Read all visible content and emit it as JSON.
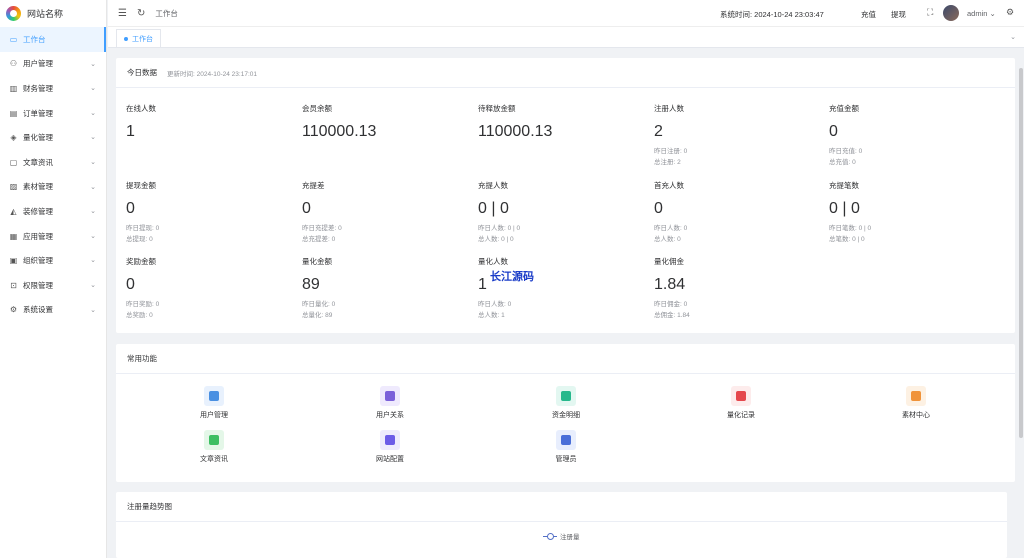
{
  "app": {
    "logo_text": "网站名称"
  },
  "sidebar": {
    "items": [
      {
        "label": "工作台",
        "icon": "monitor-icon",
        "glyph": "▭",
        "active": true,
        "has_children": false
      },
      {
        "label": "用户管理",
        "icon": "user-icon",
        "glyph": "⚇",
        "has_children": true
      },
      {
        "label": "财务管理",
        "icon": "finance-icon",
        "glyph": "▥",
        "has_children": true
      },
      {
        "label": "订单管理",
        "icon": "order-icon",
        "glyph": "▤",
        "has_children": true
      },
      {
        "label": "量化管理",
        "icon": "quant-icon",
        "glyph": "◈",
        "has_children": true
      },
      {
        "label": "文章资讯",
        "icon": "article-icon",
        "glyph": "▢",
        "has_children": true
      },
      {
        "label": "素材管理",
        "icon": "material-icon",
        "glyph": "▨",
        "has_children": true
      },
      {
        "label": "装修管理",
        "icon": "decorate-icon",
        "glyph": "◭",
        "has_children": true
      },
      {
        "label": "应用管理",
        "icon": "app-icon",
        "glyph": "▦",
        "has_children": true
      },
      {
        "label": "组织管理",
        "icon": "org-icon",
        "glyph": "▣",
        "has_children": true
      },
      {
        "label": "权限管理",
        "icon": "lock-icon",
        "glyph": "⊡",
        "has_children": true
      },
      {
        "label": "系统设置",
        "icon": "gear-icon",
        "glyph": "⚙",
        "has_children": true
      }
    ]
  },
  "header": {
    "breadcrumb": "工作台",
    "system_time_label": "系统时间: ",
    "system_time": "2024-10-24 23:03:47",
    "recharge": "充值",
    "withdraw": "提现",
    "username": "admin"
  },
  "tags": {
    "active_tag": "工作台"
  },
  "today": {
    "title": "今日数据",
    "updated_label": "更新时间: ",
    "updated_time": "2024-10-24 23:17:01",
    "stats": [
      {
        "label": "在线人数",
        "value": "1",
        "lines": []
      },
      {
        "label": "会员余额",
        "value": "110000.13",
        "lines": []
      },
      {
        "label": "待释放金额",
        "value": "110000.13",
        "lines": []
      },
      {
        "label": "注册人数",
        "value": "2",
        "lines": [
          "昨日注册: 0",
          "总注册: 2"
        ]
      },
      {
        "label": "充值金额",
        "value": "0",
        "lines": [
          "昨日充值: 0",
          "总充值: 0"
        ]
      },
      {
        "label": "提现金额",
        "value": "0",
        "lines": [
          "昨日提现: 0",
          "总提现: 0"
        ]
      },
      {
        "label": "充提差",
        "value": "0",
        "lines": [
          "昨日充提差: 0",
          "总充提差: 0"
        ]
      },
      {
        "label": "充提人数",
        "value": "0 | 0",
        "lines": [
          "昨日人数: 0 | 0",
          "总人数: 0 | 0"
        ]
      },
      {
        "label": "首充人数",
        "value": "0",
        "lines": [
          "昨日人数: 0",
          "总人数: 0"
        ]
      },
      {
        "label": "充提笔数",
        "value": "0 | 0",
        "lines": [
          "昨日笔数: 0 | 0",
          "总笔数: 0 | 0"
        ]
      },
      {
        "label": "奖励金额",
        "value": "0",
        "lines": [
          "昨日奖励: 0",
          "总奖励: 0"
        ]
      },
      {
        "label": "量化金额",
        "value": "89",
        "lines": [
          "昨日量化: 0",
          "总量化: 89"
        ]
      },
      {
        "label": "量化人数",
        "value": "1",
        "lines": [
          "昨日人数: 0",
          "总人数: 1"
        ]
      },
      {
        "label": "量化佣金",
        "value": "1.84",
        "lines": [
          "昨日佣金: 0",
          "总佣金: 1.84"
        ]
      }
    ]
  },
  "watermark": "长江源码",
  "quick": {
    "title": "常用功能",
    "items": [
      {
        "label": "用户管理",
        "icon": "user-manage-icon",
        "bg": "#e8f1fd",
        "fg": "#4a90e2"
      },
      {
        "label": "用户关系",
        "icon": "user-relation-icon",
        "bg": "#efeafd",
        "fg": "#7b61d9"
      },
      {
        "label": "资金明细",
        "icon": "fund-detail-icon",
        "bg": "#e3f7f1",
        "fg": "#27b88c"
      },
      {
        "label": "量化记录",
        "icon": "quant-record-icon",
        "bg": "#fdecec",
        "fg": "#e5484d"
      },
      {
        "label": "素材中心",
        "icon": "material-center-icon",
        "bg": "#fdf1e3",
        "fg": "#f0933a"
      },
      {
        "label": "文章资讯",
        "icon": "article-news-icon",
        "bg": "#e4f7e8",
        "fg": "#3cbf62"
      },
      {
        "label": "网站配置",
        "icon": "site-config-icon",
        "bg": "#eeebfd",
        "fg": "#6c5ce7"
      },
      {
        "label": "管理员",
        "icon": "admin-icon",
        "bg": "#e8eefd",
        "fg": "#4a6fd8"
      }
    ]
  },
  "trend": {
    "title": "注册量趋势图",
    "legend": "注册量",
    "legend_color": "#5470c6"
  }
}
